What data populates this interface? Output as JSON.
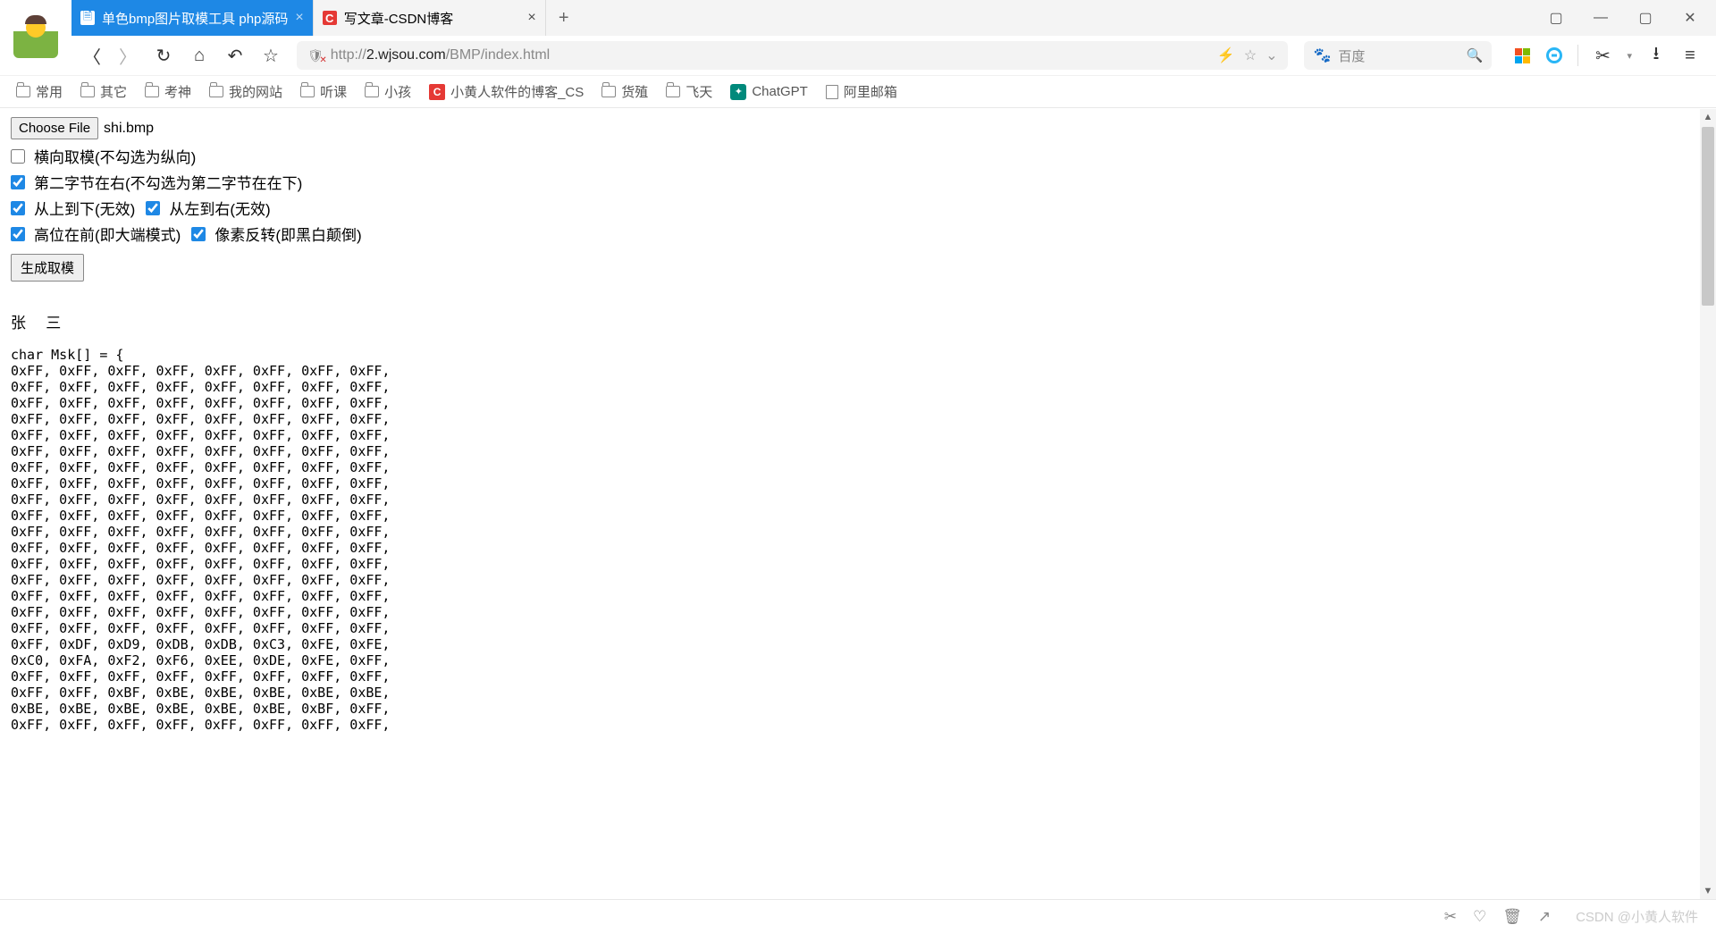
{
  "tabs": [
    {
      "title": "单色bmp图片取模工具 php源码",
      "icon": "file",
      "active": true
    },
    {
      "title": "写文章-CSDN博客",
      "icon": "csdn",
      "active": false
    }
  ],
  "url": {
    "prefix": "http://",
    "domain": "2.wjsou.com",
    "path": "/BMP/index.html"
  },
  "search_placeholder": "百度",
  "bookmarks": [
    {
      "label": "常用",
      "type": "folder"
    },
    {
      "label": "其它",
      "type": "folder"
    },
    {
      "label": "考神",
      "type": "folder"
    },
    {
      "label": "我的网站",
      "type": "folder"
    },
    {
      "label": "听课",
      "type": "folder"
    },
    {
      "label": "小孩",
      "type": "folder"
    },
    {
      "label": "小黄人软件的博客_CS",
      "type": "csdn"
    },
    {
      "label": "货殖",
      "type": "folder"
    },
    {
      "label": "飞天",
      "type": "folder"
    },
    {
      "label": "ChatGPT",
      "type": "gpt"
    },
    {
      "label": "阿里邮箱",
      "type": "page"
    }
  ],
  "page": {
    "choose_file_label": "Choose File",
    "filename": "shi.bmp",
    "checkboxes": {
      "horizontal": {
        "label": "横向取模(不勾选为纵向)",
        "checked": false
      },
      "second_right": {
        "label": "第二字节在右(不勾选为第二字节在在下)",
        "checked": true
      },
      "top_to_bottom": {
        "label": "从上到下(无效)",
        "checked": true
      },
      "left_to_right": {
        "label": "从左到右(无效)",
        "checked": true
      },
      "msb_first": {
        "label": "高位在前(即大端模式)",
        "checked": true
      },
      "invert": {
        "label": "像素反转(即黑白颠倒)",
        "checked": true
      }
    },
    "generate_label": "生成取模",
    "output_name": "张 三",
    "code_header": "char Msk[] = {",
    "code_rows": [
      "0xFF, 0xFF, 0xFF, 0xFF, 0xFF, 0xFF, 0xFF, 0xFF,",
      "0xFF, 0xFF, 0xFF, 0xFF, 0xFF, 0xFF, 0xFF, 0xFF,",
      "0xFF, 0xFF, 0xFF, 0xFF, 0xFF, 0xFF, 0xFF, 0xFF,",
      "0xFF, 0xFF, 0xFF, 0xFF, 0xFF, 0xFF, 0xFF, 0xFF,",
      "0xFF, 0xFF, 0xFF, 0xFF, 0xFF, 0xFF, 0xFF, 0xFF,",
      "0xFF, 0xFF, 0xFF, 0xFF, 0xFF, 0xFF, 0xFF, 0xFF,",
      "0xFF, 0xFF, 0xFF, 0xFF, 0xFF, 0xFF, 0xFF, 0xFF,",
      "0xFF, 0xFF, 0xFF, 0xFF, 0xFF, 0xFF, 0xFF, 0xFF,",
      "0xFF, 0xFF, 0xFF, 0xFF, 0xFF, 0xFF, 0xFF, 0xFF,",
      "0xFF, 0xFF, 0xFF, 0xFF, 0xFF, 0xFF, 0xFF, 0xFF,",
      "0xFF, 0xFF, 0xFF, 0xFF, 0xFF, 0xFF, 0xFF, 0xFF,",
      "0xFF, 0xFF, 0xFF, 0xFF, 0xFF, 0xFF, 0xFF, 0xFF,",
      "0xFF, 0xFF, 0xFF, 0xFF, 0xFF, 0xFF, 0xFF, 0xFF,",
      "0xFF, 0xFF, 0xFF, 0xFF, 0xFF, 0xFF, 0xFF, 0xFF,",
      "0xFF, 0xFF, 0xFF, 0xFF, 0xFF, 0xFF, 0xFF, 0xFF,",
      "0xFF, 0xFF, 0xFF, 0xFF, 0xFF, 0xFF, 0xFF, 0xFF,",
      "0xFF, 0xFF, 0xFF, 0xFF, 0xFF, 0xFF, 0xFF, 0xFF,",
      "0xFF, 0xDF, 0xD9, 0xDB, 0xDB, 0xC3, 0xFE, 0xFE,",
      "0xC0, 0xFA, 0xF2, 0xF6, 0xEE, 0xDE, 0xFE, 0xFF,",
      "0xFF, 0xFF, 0xFF, 0xFF, 0xFF, 0xFF, 0xFF, 0xFF,",
      "0xFF, 0xFF, 0xBF, 0xBE, 0xBE, 0xBE, 0xBE, 0xBE,",
      "0xBE, 0xBE, 0xBE, 0xBE, 0xBE, 0xBE, 0xBF, 0xFF,",
      "0xFF, 0xFF, 0xFF, 0xFF, 0xFF, 0xFF, 0xFF, 0xFF,"
    ]
  },
  "watermark": "CSDN @小黄人软件"
}
